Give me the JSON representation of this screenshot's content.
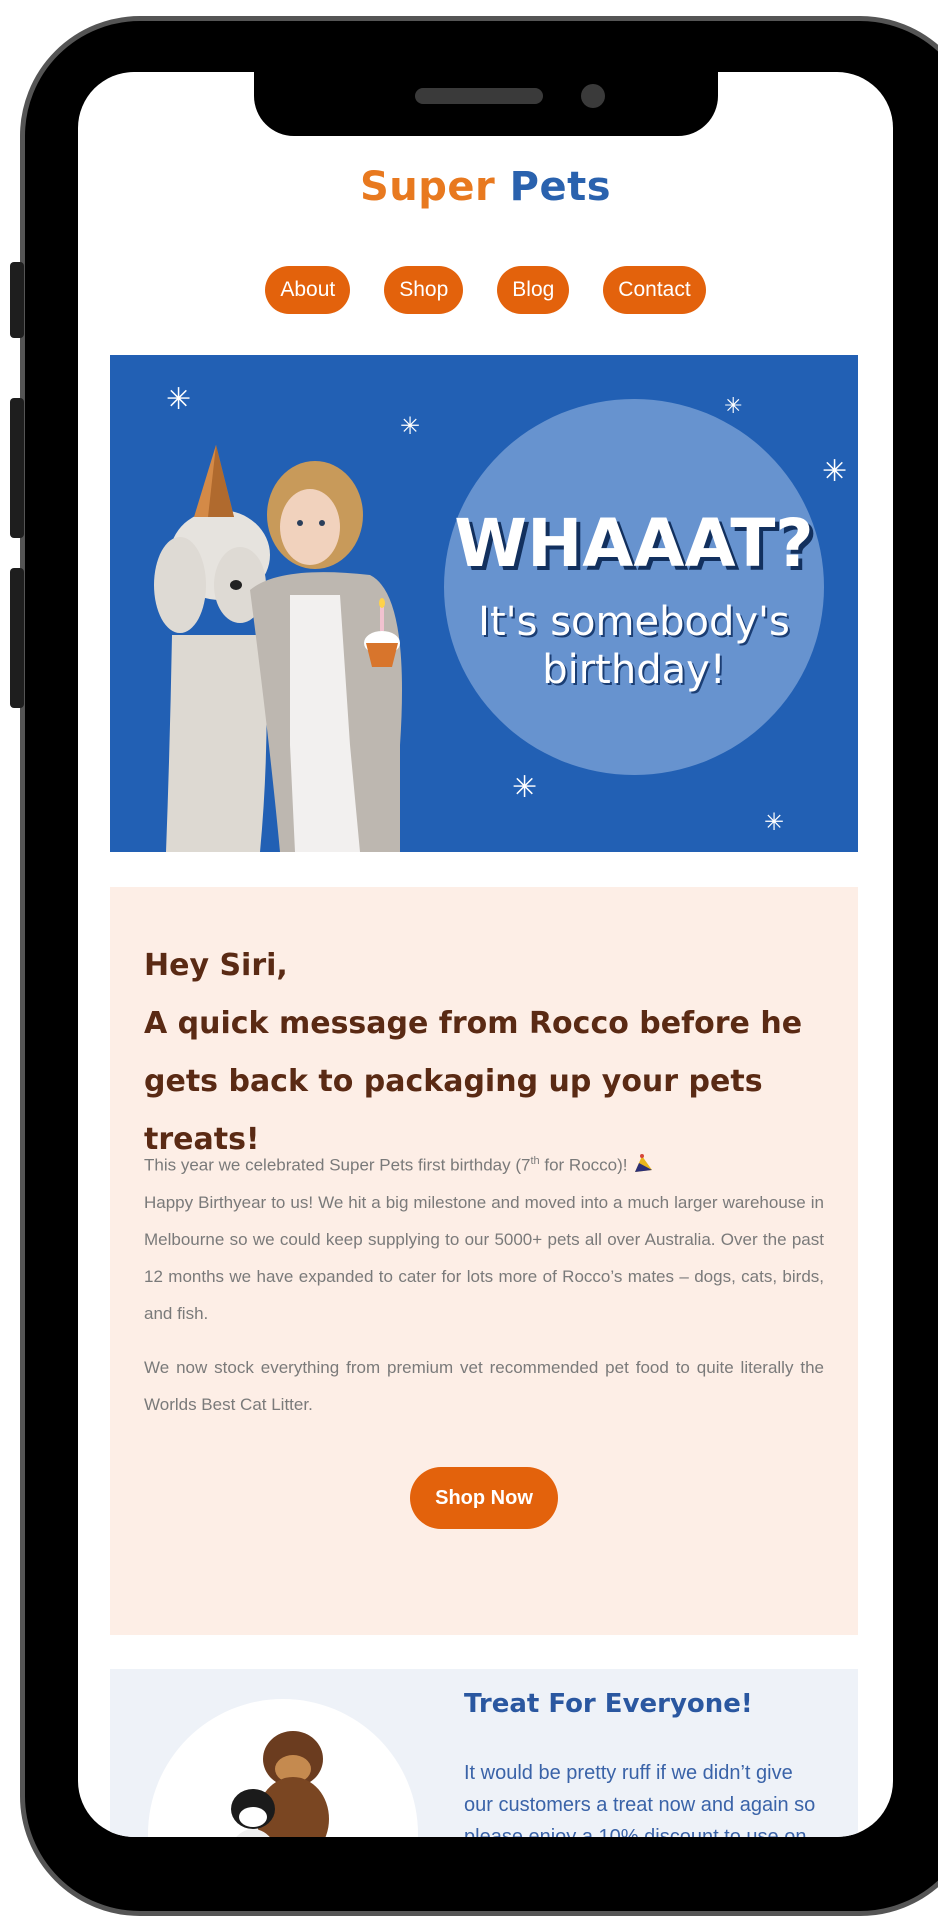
{
  "brand": {
    "part1": "Super",
    "part2": "Pets"
  },
  "nav": [
    {
      "label": "About"
    },
    {
      "label": "Shop"
    },
    {
      "label": "Blog"
    },
    {
      "label": "Contact"
    }
  ],
  "hero": {
    "title": "WHAAAT?",
    "subtitle_line1": "It's somebody's",
    "subtitle_line2": "birthday!"
  },
  "message": {
    "greeting": "Hey Siri,",
    "headline": "A quick message from Rocco before he gets back to packaging up your pets treats!",
    "p1_part1": "This year we celebrated Super Pets first birthday (7",
    "p1_sup": "th",
    "p1_part2": " for Rocco)! ",
    "p1_body": "Happy Birthyear to us! We hit a big milestone and moved into a much larger warehouse in Melbourne so we could keep supplying to our 5000+ pets all over Australia. Over the past 12 months we have expanded to cater for lots more of Rocco’s mates – dogs, cats, birds, and fish.",
    "p2": "We now stock everything from premium vet recommended pet food to quite literally the Worlds Best Cat Litter.",
    "cta": "Shop Now"
  },
  "treat": {
    "title": "Treat For Everyone!",
    "text": "It would be pretty ruff if we didn’t give our customers a treat now and again so please enjoy a 10% discount to use on your next Super Pet purchase."
  },
  "icons": {
    "party": "party-hat-icon",
    "sparkle": "sparkle-icon"
  },
  "colors": {
    "brand_orange": "#e3620c",
    "brand_blue": "#2a62ae",
    "hero_bg": "#2260b4",
    "message_bg": "#fdeee6",
    "treat_bg": "#eef2f8"
  }
}
